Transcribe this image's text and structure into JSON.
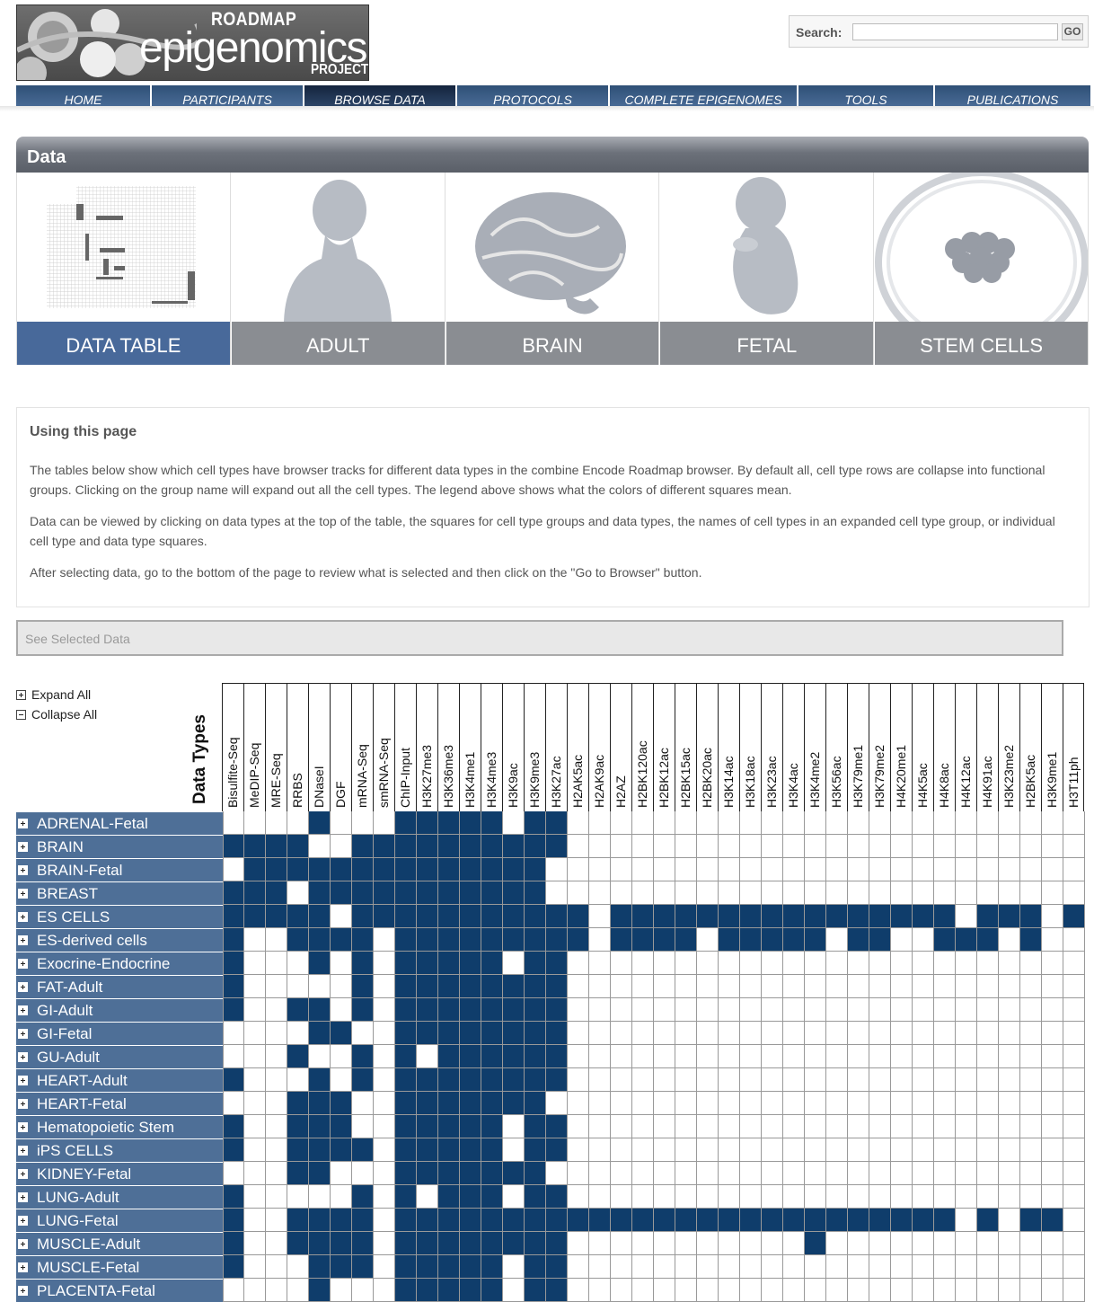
{
  "logo": {
    "line1": "ROADMAP",
    "line2": "epigenomics",
    "line3": "PROJECT"
  },
  "search": {
    "label": "Search:",
    "value": "",
    "go": "GO"
  },
  "nav": [
    {
      "label": "HOME",
      "active": false
    },
    {
      "label": "PARTICIPANTS",
      "active": false
    },
    {
      "label": "BROWSE DATA",
      "active": true
    },
    {
      "label": "PROTOCOLS",
      "active": false
    },
    {
      "label": "COMPLETE EPIGENOMES",
      "active": false
    },
    {
      "label": "TOOLS",
      "active": false
    },
    {
      "label": "PUBLICATIONS",
      "active": false
    }
  ],
  "panel": {
    "title": "Data",
    "tiles": [
      {
        "label": "DATA TABLE",
        "icon": "data-table-thumbnail-icon",
        "active": true
      },
      {
        "label": "ADULT",
        "icon": "adult-silhouette-icon",
        "active": false
      },
      {
        "label": "BRAIN",
        "icon": "brain-icon",
        "active": false
      },
      {
        "label": "FETAL",
        "icon": "fetus-icon",
        "active": false
      },
      {
        "label": "STEM CELLS",
        "icon": "stem-cells-dish-icon",
        "active": false
      }
    ]
  },
  "info": {
    "title": "Using this page",
    "paragraphs": [
      "The tables below show which cell types have browser tracks for different data types in the combine Encode Roadmap browser. By default all, cell type rows are collapse into functional groups. Clicking on the group name will expand out all the cell types. The legend above shows what the colors of different squares mean.",
      "Data can be viewed by clicking on data types at the top of the table, the squares for cell type groups and data types, the names of cell types in an expanded cell type group, or individual cell type and data type squares.",
      "After selecting data, go to the bottom of the page to review what is selected and then click on the \"Go to Browser\" button."
    ]
  },
  "selected_bar": "See Selected Data",
  "controls": {
    "expand_all": "Expand All",
    "collapse_all": "Collapse All"
  },
  "matrix": {
    "title": "Data Types",
    "columns": [
      "Bisulfite-Seq",
      "MeDIP-Seq",
      "MRE-Seq",
      "RRBS",
      "DNaseI",
      "DGF",
      "mRNA-Seq",
      "smRNA-Seq",
      "ChIP-Input",
      "H3K27me3",
      "H3K36me3",
      "H3K4me1",
      "H3K4me3",
      "H3K9ac",
      "H3K9me3",
      "H3K27ac",
      "H2AK5ac",
      "H2AK9ac",
      "H2AZ",
      "H2BK120ac",
      "H2BK12ac",
      "H2BK15ac",
      "H2BK20ac",
      "H3K14ac",
      "H3K18ac",
      "H3K23ac",
      "H3K4ac",
      "H3K4me2",
      "H3K56ac",
      "H3K79me1",
      "H3K79me2",
      "H4K20me1",
      "H4K5ac",
      "H4K8ac",
      "H4K12ac",
      "H4K91ac",
      "H3K23me2",
      "H2BK5ac",
      "H3K9me1",
      "H3T11ph"
    ],
    "rows": [
      {
        "label": "ADRENAL-Fetal",
        "cells": "0000100011111011000000000000000000000000"
      },
      {
        "label": "BRAIN",
        "cells": "1111001111111111000000000000000000000000"
      },
      {
        "label": "BRAIN-Fetal",
        "cells": "0111111111111110000000000000000000000000"
      },
      {
        "label": "BREAST",
        "cells": "1110111111111110000000000000000000000000"
      },
      {
        "label": "ES CELLS",
        "cells": "1111101111111111101111111111111111011101"
      },
      {
        "label": "ES-derived cells",
        "cells": "1001111011111111101111011111011001110100"
      },
      {
        "label": "Exocrine-Endocrine",
        "cells": "1000101011111011000000000000000000000000"
      },
      {
        "label": "FAT-Adult",
        "cells": "1000001011111111000000000000000000000000"
      },
      {
        "label": "GI-Adult",
        "cells": "1001101011111111000000000000000000000000"
      },
      {
        "label": "GI-Fetal",
        "cells": "0000110011111111000000000000000000000000"
      },
      {
        "label": "GU-Adult",
        "cells": "0001001010111111000000000000000000000000"
      },
      {
        "label": "HEART-Adult",
        "cells": "1000101011111111000000000000000000000000"
      },
      {
        "label": "HEART-Fetal",
        "cells": "0001110011111110000000000000000000000000"
      },
      {
        "label": "Hematopoietic Stem",
        "cells": "1001110011111011000000000000000000000000"
      },
      {
        "label": "iPS CELLS",
        "cells": "1001111011111011000000000000000000000000"
      },
      {
        "label": "KIDNEY-Fetal",
        "cells": "0001100011111110000000000000000000000000"
      },
      {
        "label": "LUNG-Adult",
        "cells": "1000001010111011000000000000000000000000"
      },
      {
        "label": "LUNG-Fetal",
        "cells": "1001111011111111111111111111111111010110"
      },
      {
        "label": "MUSCLE-Adult",
        "cells": "1001111011111111000000000001000000000000"
      },
      {
        "label": "MUSCLE-Fetal",
        "cells": "1000111011111011000000000000000000000000"
      },
      {
        "label": "PLACENTA-Fetal",
        "cells": "0000100011111011000000000000000000000000"
      }
    ]
  },
  "colors": {
    "nav": "#3a5c86",
    "accent": "#48699a",
    "cell_on": "#0f3d6b",
    "row_label": "#4e6f97"
  }
}
